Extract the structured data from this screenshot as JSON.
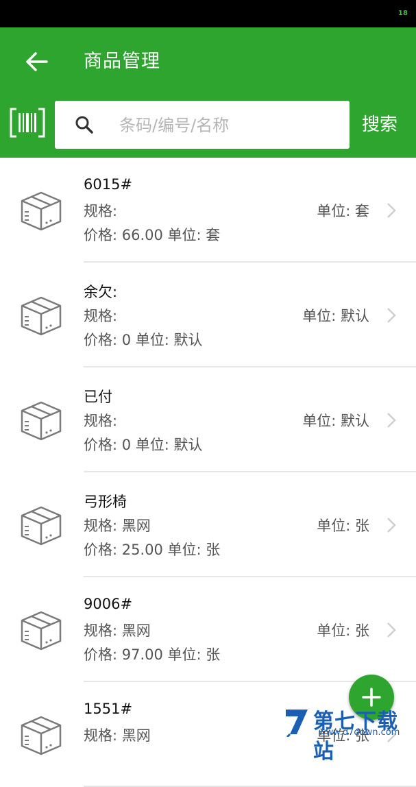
{
  "status_bar": {
    "battery_level": "18"
  },
  "header": {
    "title": "商品管理"
  },
  "search": {
    "placeholder": "条码/编号/名称",
    "button_label": "搜索"
  },
  "products": [
    {
      "name": "6015#",
      "spec": "规格:",
      "price": "价格: 66.00 单位: 套",
      "unit": "单位: 套"
    },
    {
      "name": "余欠:",
      "spec": "规格:",
      "price": "价格: 0 单位: 默认",
      "unit": "单位: 默认"
    },
    {
      "name": "已付",
      "spec": "规格:",
      "price": "价格: 0 单位: 默认",
      "unit": "单位: 默认"
    },
    {
      "name": "弓形椅",
      "spec": "规格: 黑网",
      "price": "价格: 25.00 单位: 张",
      "unit": "单位: 张"
    },
    {
      "name": "9006#",
      "spec": "规格: 黑网",
      "price": "价格: 97.00 单位: 张",
      "unit": "单位: 张"
    },
    {
      "name": "1551#",
      "spec": "规格: 黑网",
      "price": "",
      "unit": "单位: 张"
    }
  ],
  "fab": {
    "icon": "plus-icon"
  },
  "watermark": {
    "text": "第七下载站",
    "url": "www.d7down.com"
  },
  "colors": {
    "primary": "#2ea52e",
    "divider": "#e6e6e6"
  }
}
